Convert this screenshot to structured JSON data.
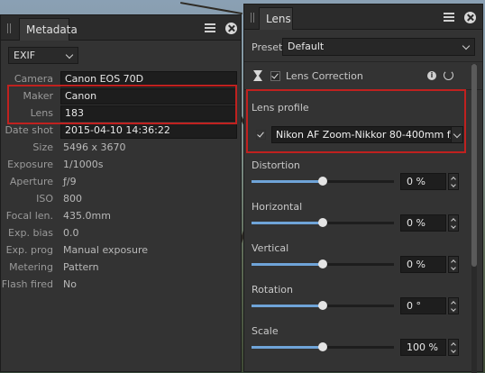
{
  "metadata_panel": {
    "title": "Metadata",
    "format_select": "EXIF",
    "rows": [
      {
        "label": "Camera",
        "value": "Canon EOS 70D",
        "field": true
      },
      {
        "label": "Maker",
        "value": "Canon",
        "field": true
      },
      {
        "label": "Lens",
        "value": "183",
        "field": true
      },
      {
        "label": "Date shot",
        "value": "2015-04-10 14:36:22",
        "field": true
      },
      {
        "label": "Size",
        "value": "5496 x 3670",
        "field": false
      },
      {
        "label": "Exposure",
        "value": "1/1000s",
        "field": false
      },
      {
        "label": "Aperture",
        "value": "ƒ/9",
        "field": false
      },
      {
        "label": "ISO",
        "value": "800",
        "field": false
      },
      {
        "label": "Focal len.",
        "value": "435.0mm",
        "field": false
      },
      {
        "label": "Exp. bias",
        "value": "0.0",
        "field": false
      },
      {
        "label": "Exp. prog",
        "value": "Manual exposure",
        "field": false
      },
      {
        "label": "Metering",
        "value": "Pattern",
        "field": false
      },
      {
        "label": "Flash fired",
        "value": "No",
        "field": false
      }
    ]
  },
  "lens_panel": {
    "title": "Lens",
    "preset_label": "Preset:",
    "preset_value": "Default",
    "lens_correction_label": "Lens Correction",
    "lens_correction_checked": true,
    "lens_profile_label": "Lens profile",
    "lens_profile_value": "Nikon AF Zoom-Nikkor 80-400mm f/",
    "lens_profile_checked": true,
    "sliders": [
      {
        "label": "Distortion",
        "value": "0 %",
        "position": 0.5
      },
      {
        "label": "Horizontal",
        "value": "0 %",
        "position": 0.5
      },
      {
        "label": "Vertical",
        "value": "0 %",
        "position": 0.5
      },
      {
        "label": "Rotation",
        "value": "0 °",
        "position": 0.5
      },
      {
        "label": "Scale",
        "value": "100 %",
        "position": 0.5
      }
    ]
  },
  "colors": {
    "highlight": "#c0211f",
    "slider_fill": "#6fa4d8",
    "panel_bg": "#333333"
  },
  "icons": [
    "grip-icon",
    "menu-icon",
    "close-icon",
    "chevron-down-icon",
    "lens-correction-icon",
    "info-icon",
    "reset-icon",
    "checkbox-icon"
  ]
}
